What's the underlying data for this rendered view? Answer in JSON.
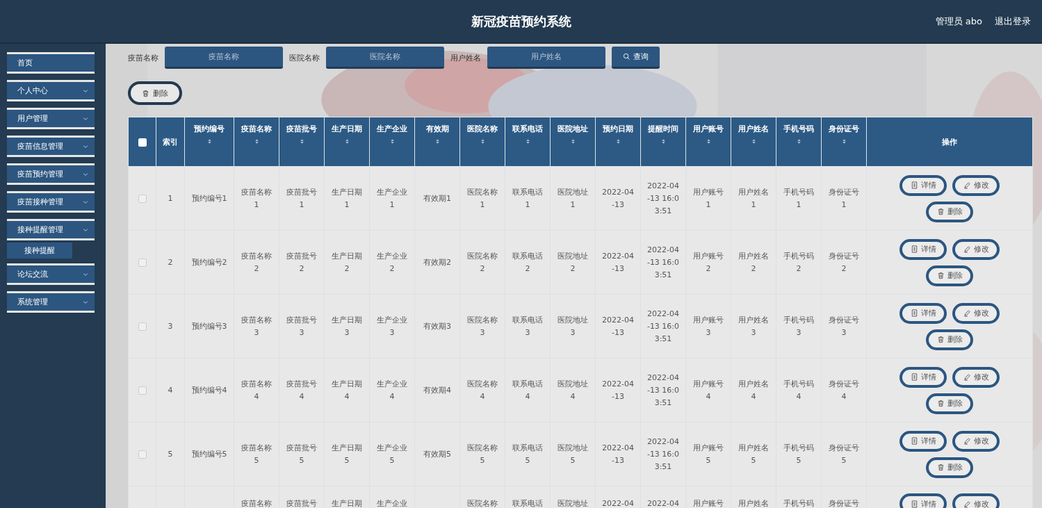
{
  "header": {
    "title": "新冠疫苗预约系统",
    "user": "管理员 abo",
    "logout": "退出登录"
  },
  "sidebar": {
    "items": [
      {
        "label": "首页",
        "expandable": false
      },
      {
        "label": "个人中心",
        "expandable": true
      },
      {
        "label": "用户管理",
        "expandable": true
      },
      {
        "label": "疫苗信息管理",
        "expandable": true
      },
      {
        "label": "疫苗预约管理",
        "expandable": true
      },
      {
        "label": "疫苗接种管理",
        "expandable": true
      },
      {
        "label": "接种提醒管理",
        "expandable": true,
        "children": [
          {
            "label": "接种提醒"
          }
        ]
      },
      {
        "label": "论坛交流",
        "expandable": true
      },
      {
        "label": "系统管理",
        "expandable": true
      }
    ]
  },
  "search": {
    "fields": [
      {
        "label": "疫苗名称",
        "placeholder": "疫苗名称"
      },
      {
        "label": "医院名称",
        "placeholder": "医院名称"
      },
      {
        "label": "用户姓名",
        "placeholder": "用户姓名"
      }
    ],
    "button": "查询"
  },
  "toolbar": {
    "delete_button": "删除"
  },
  "table": {
    "columns": [
      {
        "kind": "checkbox",
        "checked": false
      },
      {
        "kind": "text",
        "label": "索引"
      },
      {
        "kind": "sortable",
        "label": "预约编号"
      },
      {
        "kind": "sortable",
        "label": "疫苗名称"
      },
      {
        "kind": "sortable",
        "label": "疫苗批号"
      },
      {
        "kind": "sortable",
        "label": "生产日期"
      },
      {
        "kind": "sortable",
        "label": "生产企业"
      },
      {
        "kind": "sortable",
        "label": "有效期"
      },
      {
        "kind": "sortable",
        "label": "医院名称"
      },
      {
        "kind": "sortable",
        "label": "联系电话"
      },
      {
        "kind": "sortable",
        "label": "医院地址"
      },
      {
        "kind": "sortable",
        "label": "预约日期"
      },
      {
        "kind": "sortable",
        "label": "提醒时间"
      },
      {
        "kind": "sortable",
        "label": "用户账号"
      },
      {
        "kind": "sortable",
        "label": "用户姓名"
      },
      {
        "kind": "sortable",
        "label": "手机号码"
      },
      {
        "kind": "sortable",
        "label": "身份证号"
      },
      {
        "kind": "actions",
        "label": "操作"
      }
    ],
    "rows": [
      {
        "kind": "full",
        "selected": false,
        "cells": [
          "",
          "1",
          "预约编号1",
          "疫苗名称1",
          "疫苗批号1",
          "生产日期1",
          "生产企业1",
          "有效期1",
          "医院名称1",
          "联系电话1",
          "医院地址1",
          "2022-04-13",
          "2022-04-13 16:03:51",
          "用户账号1",
          "用户姓名1",
          "手机号码1",
          "身份证号1"
        ],
        "actions": [
          "详情",
          "修改",
          "删除"
        ]
      },
      {
        "kind": "full",
        "selected": false,
        "cells": [
          "",
          "2",
          "预约编号2",
          "疫苗名称2",
          "疫苗批号2",
          "生产日期2",
          "生产企业2",
          "有效期2",
          "医院名称2",
          "联系电话2",
          "医院地址2",
          "2022-04-13",
          "2022-04-13 16:03:51",
          "用户账号2",
          "用户姓名2",
          "手机号码2",
          "身份证号2"
        ],
        "actions": [
          "详情",
          "修改",
          "删除"
        ]
      },
      {
        "kind": "full",
        "selected": false,
        "cells": [
          "",
          "3",
          "预约编号3",
          "疫苗名称3",
          "疫苗批号3",
          "生产日期3",
          "生产企业3",
          "有效期3",
          "医院名称3",
          "联系电话3",
          "医院地址3",
          "2022-04-13",
          "2022-04-13 16:03:51",
          "用户账号3",
          "用户姓名3",
          "手机号码3",
          "身份证号3"
        ],
        "actions": [
          "详情",
          "修改",
          "删除"
        ]
      },
      {
        "kind": "full",
        "selected": false,
        "cells": [
          "",
          "4",
          "预约编号4",
          "疫苗名称4",
          "疫苗批号4",
          "生产日期4",
          "生产企业4",
          "有效期4",
          "医院名称4",
          "联系电话4",
          "医院地址4",
          "2022-04-13",
          "2022-04-13 16:03:51",
          "用户账号4",
          "用户姓名4",
          "手机号码4",
          "身份证号4"
        ],
        "actions": [
          "详情",
          "修改",
          "删除"
        ]
      },
      {
        "kind": "full",
        "selected": false,
        "cells": [
          "",
          "5",
          "预约编号5",
          "疫苗名称5",
          "疫苗批号5",
          "生产日期5",
          "生产企业5",
          "有效期5",
          "医院名称5",
          "联系电话5",
          "医院地址5",
          "2022-04-13",
          "2022-04-13 16:03:51",
          "用户账号5",
          "用户姓名5",
          "手机号码5",
          "身份证号5"
        ],
        "actions": [
          "详情",
          "修改",
          "删除"
        ]
      },
      {
        "kind": "partial",
        "cells": [
          "",
          "",
          "",
          "疫苗名称",
          "疫苗批号",
          "生产日期",
          "生产企业",
          "",
          "医院名称",
          "联系电话",
          "医院地址",
          "2022-04",
          "2022-04",
          "用户账号",
          "用户姓名",
          "手机号码",
          "身份证号"
        ],
        "actions": [
          "详情",
          "修改"
        ]
      }
    ]
  }
}
